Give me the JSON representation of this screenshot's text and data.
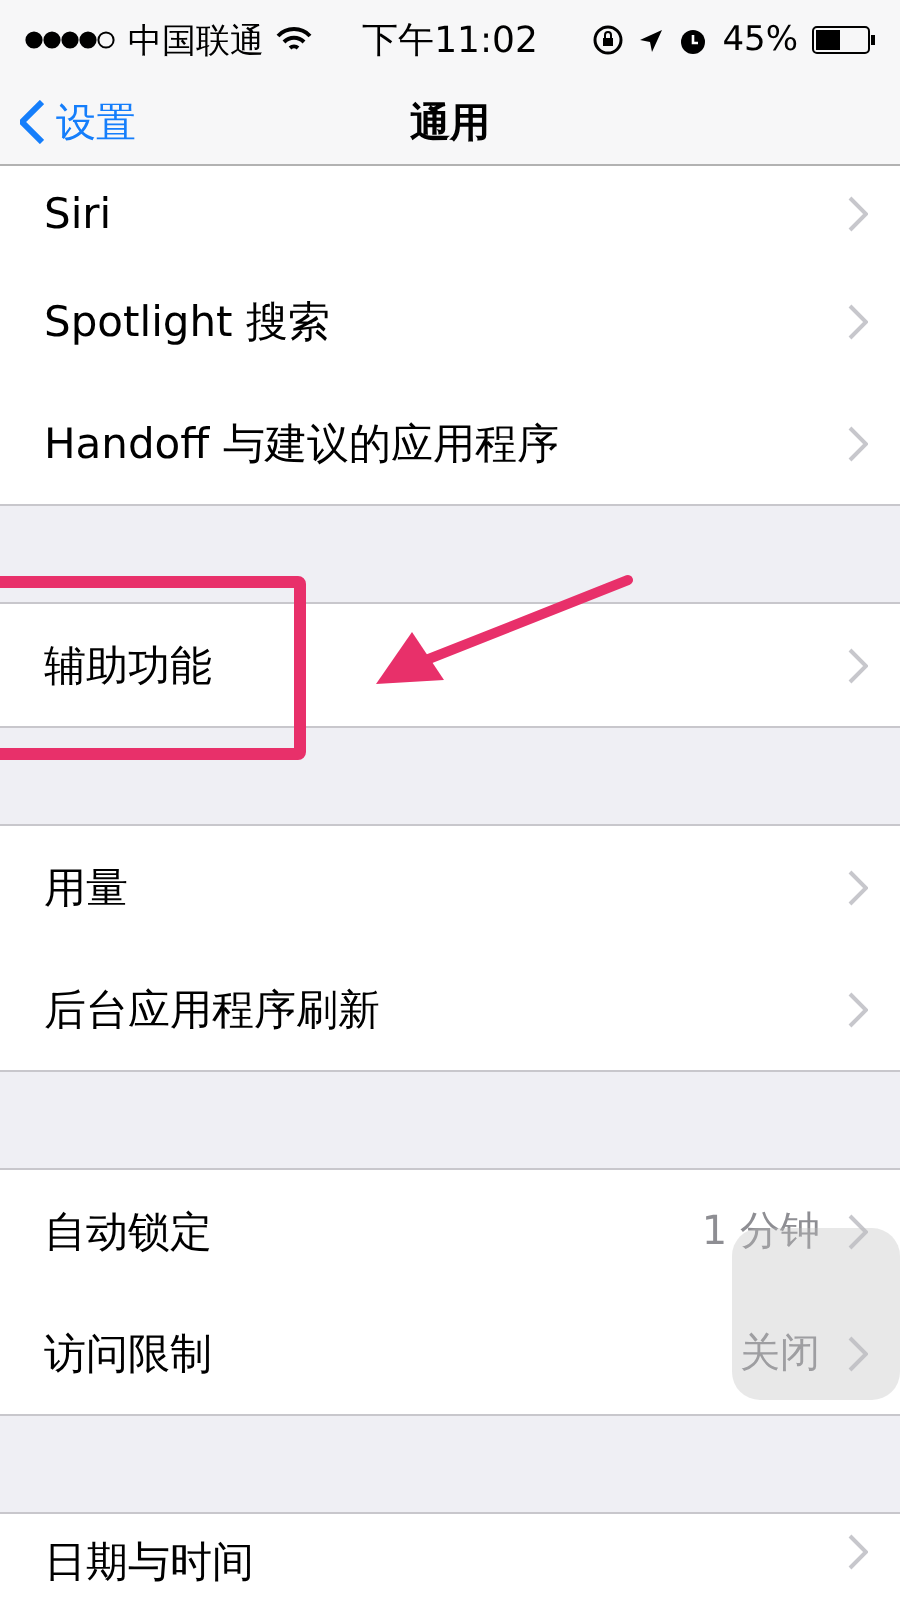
{
  "status_bar": {
    "carrier": "中国联通",
    "time": "下午11:02",
    "battery": "45%"
  },
  "nav_bar": {
    "back": "设置",
    "title": "通用"
  },
  "groups": [
    {
      "rows": [
        {
          "label": "Siri",
          "annotated": false
        },
        {
          "label": "Spotlight 搜索",
          "annotated": false
        },
        {
          "label": "Handoff 与建议的应用程序",
          "annotated": false
        }
      ]
    },
    {
      "rows": [
        {
          "label": "辅助功能",
          "annotated": true
        }
      ]
    },
    {
      "rows": [
        {
          "label": "用量",
          "annotated": false
        },
        {
          "label": "后台应用程序刷新",
          "annotated": false
        }
      ]
    },
    {
      "rows": [
        {
          "label": "自动锁定",
          "value": "1 分钟",
          "annotated": false
        },
        {
          "label": "访问限制",
          "value": "关闭",
          "annotated": false
        }
      ]
    },
    {
      "rows": [
        {
          "label": "日期与时间",
          "annotated": false
        }
      ]
    }
  ]
}
